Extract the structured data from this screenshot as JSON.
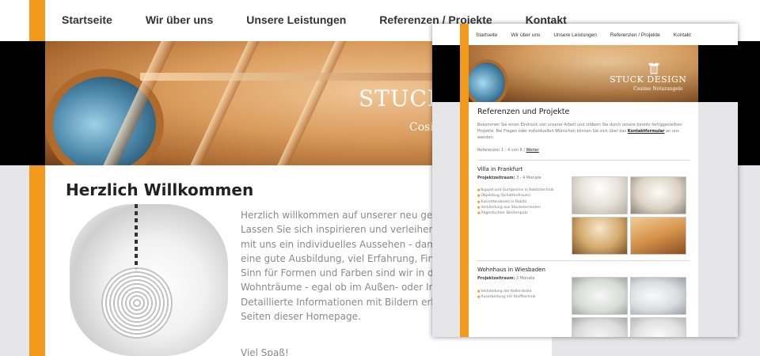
{
  "background_page": {
    "nav": [
      "Startseite",
      "Wir über uns",
      "Unsere Leistungen",
      "Referenzen / Projekte",
      "Kontakt"
    ],
    "hero": {
      "brand": "STUCK",
      "subtitle": "Cosim"
    },
    "title": "Herzlich Willkommen",
    "paragraph_lines": [
      "Herzlich willkommen auf unserer neu gestaltete",
      "Lassen Sie sich inspirieren und verleihen Sie Ihr",
      "mit uns ein individuelles Aussehen - damit Woh",
      "eine gute Ausbildung, viel Erfahrung, Fingers",
      "Sinn für Formen und Farben sind wir in der La",
      "Wohnträume - egal ob im Außen- oder Innenber",
      "Detaillierte Informationen mit Bildern erhalte",
      "Seiten dieser Homepage."
    ],
    "closing": "Viel Spaß!"
  },
  "foreground_page": {
    "nav": [
      "Startseite",
      "Wir über uns",
      "Unsere Leistungen",
      "Referenzen / Projekte",
      "Kontakt"
    ],
    "logo": {
      "brand": "STUCK  DESIGN",
      "owner": "Cosimo Notarangelo"
    },
    "title": "Referenzen und Projekte",
    "intro": {
      "text_before": "Bekommen Sie einen Eindruck von unserer Arbeit und stöbern Sie durch unsere bereits fertiggestellten Projekte. Bei Fragen oder individuellen Wünschen können Sie sich über das ",
      "link": "Kontaktformular",
      "text_after": " an uns wenden."
    },
    "pager": {
      "text": "Referenzen 1 - 4 von 8 |",
      "next": "Weiter"
    },
    "projects": [
      {
        "title": "Villa in Frankfurt",
        "period_label": "Projektzeitraum:",
        "period_value": "3 - 4 Monate",
        "items": [
          "Kuppel und Gurtgesims in Rabitztechnik",
          "Objektzug (Schattenfraum)",
          "Kassettendecke in Rabitz",
          "Verkleidung aus Stuckelementen",
          "Abgestuckter Deckenputz"
        ]
      },
      {
        "title": "Wohnhaus in Wiesbaden",
        "period_label": "Projektzeitraum:",
        "period_value": "2 Monate",
        "items": [
          "Verkleidung der Kellerdecke",
          "Ausarbeitung mit Stufftechnik"
        ]
      }
    ]
  },
  "colors": {
    "accent": "#f39a1d",
    "page_bg": "#e6e6e9",
    "hero_band": "#000000"
  }
}
